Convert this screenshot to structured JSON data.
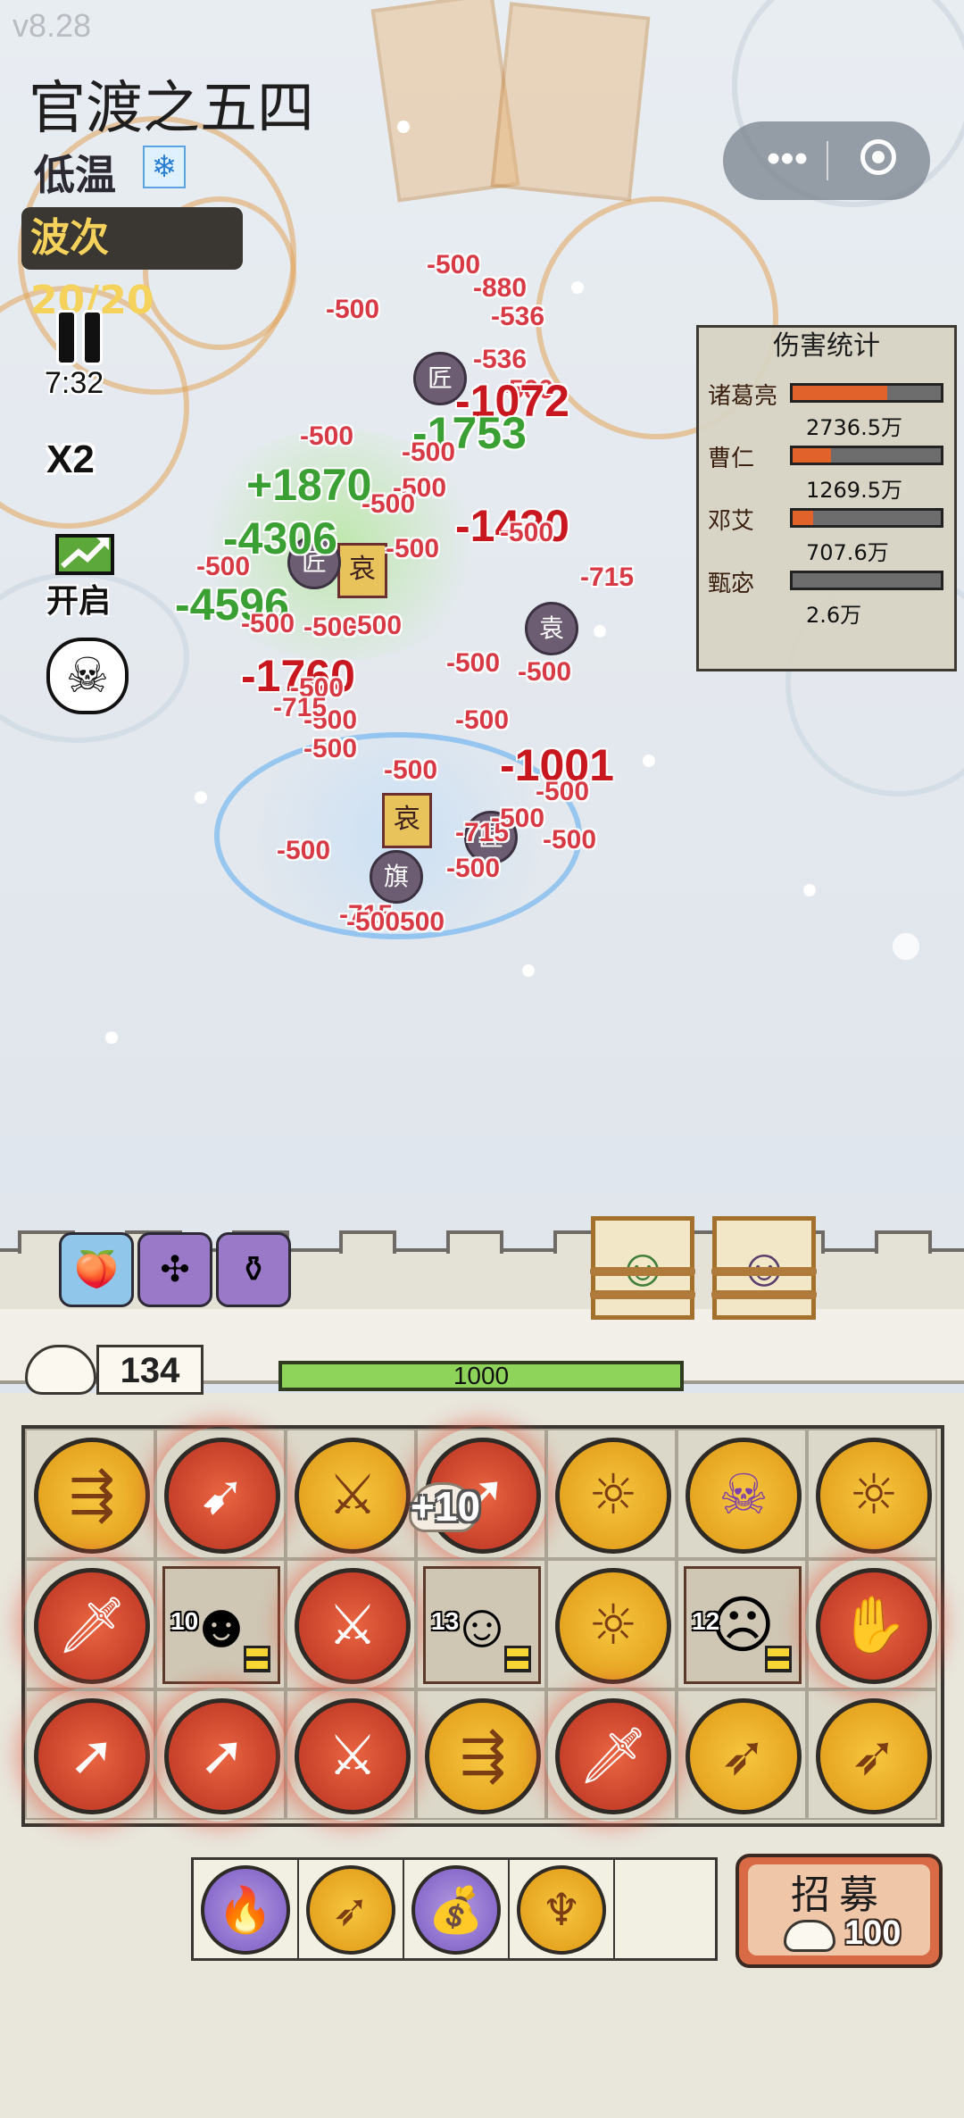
{
  "version": "v8.28",
  "stage": {
    "title": "官渡之五四",
    "weather": "低温",
    "weather_icon": "snowflake-icon",
    "wave_label": "波次 20/20"
  },
  "controls": {
    "pause_icon": "pause-icon",
    "timer": "7:32",
    "speed": "X2",
    "auto_label": "开启",
    "skull_icon": "skull-icon"
  },
  "capsule": {
    "more_icon": "more-dots-icon",
    "close_icon": "target-icon"
  },
  "damage_stats": {
    "title": "伤害统计",
    "rows": [
      {
        "name": "诸葛亮",
        "value": "2736.5万",
        "fraction": 0.64
      },
      {
        "name": "曹仁",
        "value": "1269.5万",
        "fraction": 0.26
      },
      {
        "name": "邓艾",
        "value": "707.6万",
        "fraction": 0.14
      },
      {
        "name": "甄宓",
        "value": "2.6万",
        "fraction": 0.0
      }
    ]
  },
  "battle_numbers": [
    "-500",
    "-880",
    "-536",
    "-500",
    "-536",
    "-500",
    "-1072",
    "-1753",
    "-500",
    "-500",
    "+1870",
    "-500",
    "-500",
    "-1430",
    "-500",
    "-4306",
    "-500",
    "-715",
    "-4596",
    "-500",
    "-500",
    "-500",
    "-500",
    "-1760",
    "-500",
    "-500",
    "-500",
    "-500",
    "-715",
    "-500",
    "-1001",
    "-500",
    "-500",
    "-500",
    "-715",
    "-500",
    "-500",
    "-715",
    "-500",
    "-500500",
    "-500"
  ],
  "enemy_glyphs": [
    "匠",
    "哀",
    "旗",
    "袁"
  ],
  "buffs": [
    "peach-icon",
    "spread-arrows-icon",
    "pot-icon"
  ],
  "heroes": [
    "guan-yu-portrait",
    "zhen-mi-portrait"
  ],
  "resources": {
    "buns": "134",
    "wall_hp": "1000",
    "wall_hp_fraction": 1.0
  },
  "board": {
    "rows": [
      [
        {
          "kind": "coin",
          "color": "gold",
          "icon": "triple-arrow-icon",
          "glow": false
        },
        {
          "kind": "coin",
          "color": "red",
          "icon": "arrow-volley-icon",
          "glow": true
        },
        {
          "kind": "coin",
          "color": "gold",
          "icon": "sword-slash-icon",
          "glow": false
        },
        {
          "kind": "coin",
          "color": "red",
          "icon": "single-arrow-icon",
          "glow": true
        },
        {
          "kind": "coin",
          "color": "gold",
          "icon": "sun-compass-icon",
          "glow": false
        },
        {
          "kind": "coin",
          "color": "gold",
          "icon": "purple-skull-icon",
          "glow": false
        },
        {
          "kind": "coin",
          "color": "gold",
          "icon": "sun-compass-icon",
          "glow": false
        }
      ],
      [
        {
          "kind": "coin",
          "color": "red",
          "icon": "sword-upgrade-icon",
          "glow": true
        },
        {
          "kind": "unit",
          "icon": "reaper-hero-portrait",
          "level": "10"
        },
        {
          "kind": "coin",
          "color": "red",
          "icon": "sword-slash-icon",
          "glow": true
        },
        {
          "kind": "unit",
          "icon": "farmer-hero-portrait",
          "level": "13"
        },
        {
          "kind": "coin",
          "color": "gold",
          "icon": "sun-compass-icon",
          "glow": false
        },
        {
          "kind": "unit",
          "icon": "masked-hero-portrait",
          "level": "12"
        },
        {
          "kind": "coin",
          "color": "red",
          "icon": "hand-grab-icon",
          "glow": true
        }
      ],
      [
        {
          "kind": "coin",
          "color": "red",
          "icon": "single-arrow-icon",
          "glow": true
        },
        {
          "kind": "coin",
          "color": "red",
          "icon": "single-arrow-icon",
          "glow": true
        },
        {
          "kind": "coin",
          "color": "red",
          "icon": "sword-slash-icon",
          "glow": true
        },
        {
          "kind": "coin",
          "color": "gold",
          "icon": "triple-arrow-icon",
          "glow": false
        },
        {
          "kind": "coin",
          "color": "red",
          "icon": "sword-upgrade-icon",
          "glow": true
        },
        {
          "kind": "coin",
          "color": "gold",
          "icon": "fire-arrow-icon",
          "glow": false
        },
        {
          "kind": "coin",
          "color": "gold",
          "icon": "fire-arrow-icon",
          "glow": false
        }
      ]
    ],
    "float_bonus": "+10"
  },
  "hand": [
    {
      "color": "purple",
      "icon": "flame-icon"
    },
    {
      "color": "gold",
      "icon": "fire-arrow-icon"
    },
    {
      "color": "purple",
      "icon": "money-bag-icon"
    },
    {
      "color": "gold",
      "icon": "claw-icon"
    },
    null
  ],
  "recruit": {
    "label": "招募",
    "cost": "100"
  }
}
